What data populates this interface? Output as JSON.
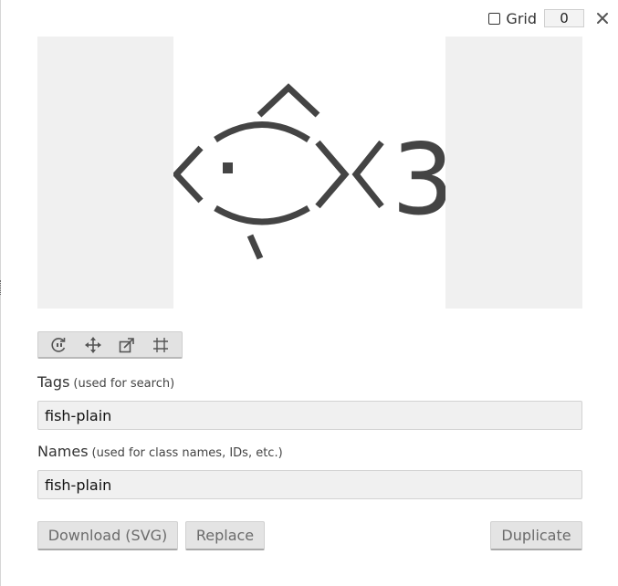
{
  "grid": {
    "label": "Grid",
    "value": "0",
    "checked": false
  },
  "close": {
    "icon": "close-icon"
  },
  "toolbar": {
    "tools": [
      {
        "icon": "rotate-icon"
      },
      {
        "icon": "move-icon"
      },
      {
        "icon": "resize-icon"
      },
      {
        "icon": "crop-icon"
      }
    ]
  },
  "tags": {
    "label": "Tags",
    "hint": "(used for search)",
    "value": "fish-plain"
  },
  "names": {
    "label": "Names",
    "hint": "(used for class names, IDs, etc.)",
    "value": "fish-plain"
  },
  "buttons": {
    "download": "Download (SVG)",
    "replace": "Replace",
    "duplicate": "Duplicate"
  },
  "preview": {
    "glyph_text": "3"
  }
}
